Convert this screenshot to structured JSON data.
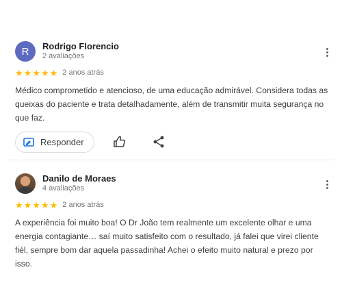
{
  "reviews": [
    {
      "name": "Rodrigo Florencio",
      "avatar_letter": "R",
      "review_count": "2 avaliações",
      "rating": 5,
      "time": "2 anos atrás",
      "text": "Médico comprometido e atencioso, de uma educação admirável. Considera todas as queixas do paciente e trata detalhadamente, além de transmitir muita segurança no que faz."
    },
    {
      "name": "Danilo de Moraes",
      "review_count": "4 avaliações",
      "rating": 5,
      "time": "2 anos atrás",
      "text": "A experiência foi muito boa! O Dr João tem realmente um excelente olhar e uma energia contagiante… saí muito satisfeito com o resultado, já falei que virei cliente fiél, sempre bom dar aquela passadinha! Achei o efeito muito natural e prezo por isso."
    }
  ],
  "actions": {
    "reply_label": "Responder"
  },
  "colors": {
    "star": "#fbbc04",
    "avatar_letter_bg": "#5c6bc0",
    "reply_icon": "#1a73e8"
  },
  "icons": [
    "more-vert-icon",
    "reply-icon",
    "thumbs-up-icon",
    "share-icon",
    "star-icon"
  ]
}
